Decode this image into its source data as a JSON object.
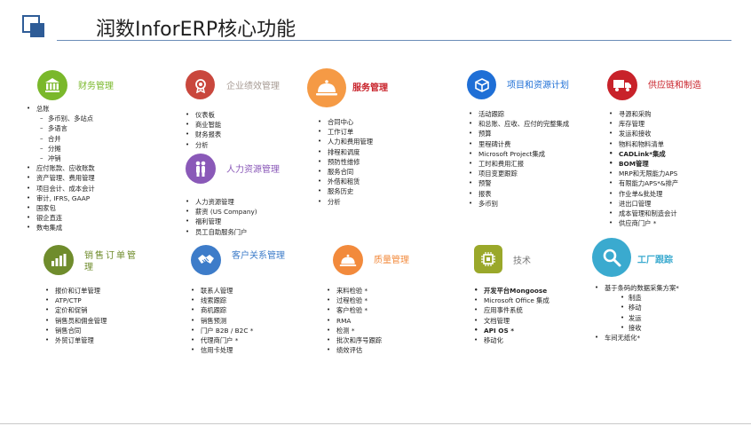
{
  "title": "润数InforERP核心功能",
  "colors": {
    "finance": "#7ab82b",
    "performance": "#c9473d",
    "service": "#f59a45",
    "project": "#1f6fd6",
    "supply": "#c8222a",
    "hr": "#8a59b8",
    "sales": "#6f8c2c",
    "crm": "#3d7cc9",
    "quality": "#f28a3c",
    "tech": "#9aa82a",
    "factory": "#3aaacf"
  },
  "modules": {
    "finance": {
      "icon": "bank-icon",
      "title": "财务管理",
      "items": [
        {
          "t": "总账",
          "lvl": 0
        },
        {
          "t": "多币别、多站点",
          "lvl": 1
        },
        {
          "t": "多语言",
          "lvl": 1
        },
        {
          "t": "合并",
          "lvl": 1
        },
        {
          "t": "分摊",
          "lvl": 1
        },
        {
          "t": "冲销",
          "lvl": 1
        },
        {
          "t": "应付账款、应收账款",
          "lvl": 0
        },
        {
          "t": "资产管理、费用管理",
          "lvl": 0
        },
        {
          "t": "项目会计、成本会计",
          "lvl": 0
        },
        {
          "t": "审计, IFRS, GAAP",
          "lvl": 0
        },
        {
          "t": "国家包",
          "lvl": 0
        },
        {
          "t": "银企直连",
          "lvl": 0
        },
        {
          "t": "数电集成",
          "lvl": 0
        }
      ]
    },
    "performance": {
      "icon": "award-icon",
      "title": "企业绩效管理",
      "items": [
        {
          "t": "仪表板",
          "lvl": 0
        },
        {
          "t": "商业智能",
          "lvl": 0
        },
        {
          "t": "财务报表",
          "lvl": 0
        },
        {
          "t": "分析",
          "lvl": 0
        }
      ]
    },
    "hr": {
      "icon": "people-icon",
      "title": "人力资源管理",
      "items": [
        {
          "t": "人力资源管理",
          "lvl": 0
        },
        {
          "t": "薪资 (US Company)",
          "lvl": 0
        },
        {
          "t": "福利管理",
          "lvl": 0
        },
        {
          "t": "员工自助服务门户",
          "lvl": 0
        }
      ]
    },
    "service": {
      "icon": "service-bell-icon",
      "title": "服务管理",
      "items": [
        {
          "t": "合同中心",
          "lvl": 0
        },
        {
          "t": "工作订单",
          "lvl": 0
        },
        {
          "t": "人力和费用管理",
          "lvl": 0
        },
        {
          "t": "排程和调度",
          "lvl": 0
        },
        {
          "t": "预防性维修",
          "lvl": 0
        },
        {
          "t": "服务合同",
          "lvl": 0
        },
        {
          "t": "外借和租赁",
          "lvl": 0
        },
        {
          "t": "服务历史",
          "lvl": 0
        },
        {
          "t": "分析",
          "lvl": 0
        }
      ]
    },
    "project": {
      "icon": "cube-icon",
      "title": "项目和资源计划",
      "items": [
        {
          "t": "活动跟踪",
          "lvl": 0
        },
        {
          "t": "和总账、应收、应付的完整集成",
          "lvl": 0
        },
        {
          "t": "预算",
          "lvl": 0
        },
        {
          "t": "里程碑计费",
          "lvl": 0
        },
        {
          "t": "Microsoft Project集成",
          "lvl": 0
        },
        {
          "t": "工时和费用汇报",
          "lvl": 0
        },
        {
          "t": "项目变更跟踪",
          "lvl": 0
        },
        {
          "t": "预警",
          "lvl": 0
        },
        {
          "t": "报表",
          "lvl": 0
        },
        {
          "t": "多币别",
          "lvl": 0
        }
      ]
    },
    "supply": {
      "icon": "truck-icon",
      "title": "供应链和制造",
      "items": [
        {
          "t": "寻源和采购",
          "lvl": 0,
          "b": false
        },
        {
          "t": "库存管理",
          "lvl": 0,
          "b": false
        },
        {
          "t": "发运和接收",
          "lvl": 0,
          "b": false
        },
        {
          "t": "物料和物料清单",
          "lvl": 0,
          "b": false
        },
        {
          "t": "CADLink*集成",
          "lvl": 0,
          "b": true
        },
        {
          "t": "BOM管理",
          "lvl": 0,
          "b": true
        },
        {
          "t": "MRP和无限能力APS",
          "lvl": 0,
          "b": false
        },
        {
          "t": "有限能力APS*&排产",
          "lvl": 0,
          "b": false
        },
        {
          "t": "作业单&批处理",
          "lvl": 0,
          "b": false
        },
        {
          "t": "进出口管理",
          "lvl": 0,
          "b": false
        },
        {
          "t": "成本管理和制造会计",
          "lvl": 0,
          "b": false
        },
        {
          "t": "供应商门户 *",
          "lvl": 0,
          "b": false
        }
      ]
    },
    "sales": {
      "icon": "bar-chart-icon",
      "title": "销售订单管理",
      "items": [
        {
          "t": "报价和订单管理",
          "lvl": 0
        },
        {
          "t": "ATP/CTP",
          "lvl": 0
        },
        {
          "t": "定价和促销",
          "lvl": 0
        },
        {
          "t": "销售员和佣金管理",
          "lvl": 0
        },
        {
          "t": "销售合同",
          "lvl": 0
        },
        {
          "t": "外贸订单管理",
          "lvl": 0
        }
      ]
    },
    "crm": {
      "icon": "handshake-icon",
      "title": "客户关系管理",
      "items": [
        {
          "t": "联系人管理",
          "lvl": 0
        },
        {
          "t": "线索跟踪",
          "lvl": 0
        },
        {
          "t": "商机跟踪",
          "lvl": 0
        },
        {
          "t": "销售预测",
          "lvl": 0
        },
        {
          "t": "门户 B2B / B2C *",
          "lvl": 0
        },
        {
          "t": "代理商门户 *",
          "lvl": 0
        },
        {
          "t": "信用卡处理",
          "lvl": 0
        }
      ]
    },
    "quality": {
      "icon": "service-bell-icon",
      "title": "质量管理",
      "items": [
        {
          "t": "来料检验 *",
          "lvl": 0
        },
        {
          "t": "过程检验 *",
          "lvl": 0
        },
        {
          "t": "客户检验 *",
          "lvl": 0
        },
        {
          "t": "RMA",
          "lvl": 0
        },
        {
          "t": "检测 *",
          "lvl": 0
        },
        {
          "t": "批次和序号跟踪",
          "lvl": 0
        },
        {
          "t": "绩效评估",
          "lvl": 0
        }
      ]
    },
    "tech": {
      "icon": "chip-icon",
      "title": "技术",
      "items": [
        {
          "t": "开发平台Mongoose",
          "lvl": 0,
          "b": true
        },
        {
          "t": "Microsoft Office 集成",
          "lvl": 0,
          "b": false
        },
        {
          "t": "应用事件系统",
          "lvl": 0,
          "b": false
        },
        {
          "t": "文档管理",
          "lvl": 0,
          "b": false
        },
        {
          "t": "API OS *",
          "lvl": 0,
          "b": true
        },
        {
          "t": "移动化",
          "lvl": 0,
          "b": false
        }
      ]
    },
    "factory": {
      "icon": "magnifier-icon",
      "title": "工厂跟踪",
      "items": [
        {
          "t": "基于条码的数据采集方案*",
          "lvl": 0
        },
        {
          "t": "制造",
          "lvl": 2
        },
        {
          "t": "移动",
          "lvl": 2
        },
        {
          "t": "发运",
          "lvl": 2
        },
        {
          "t": "接收",
          "lvl": 2
        },
        {
          "t": "车间无纸化*",
          "lvl": 0
        }
      ]
    }
  }
}
